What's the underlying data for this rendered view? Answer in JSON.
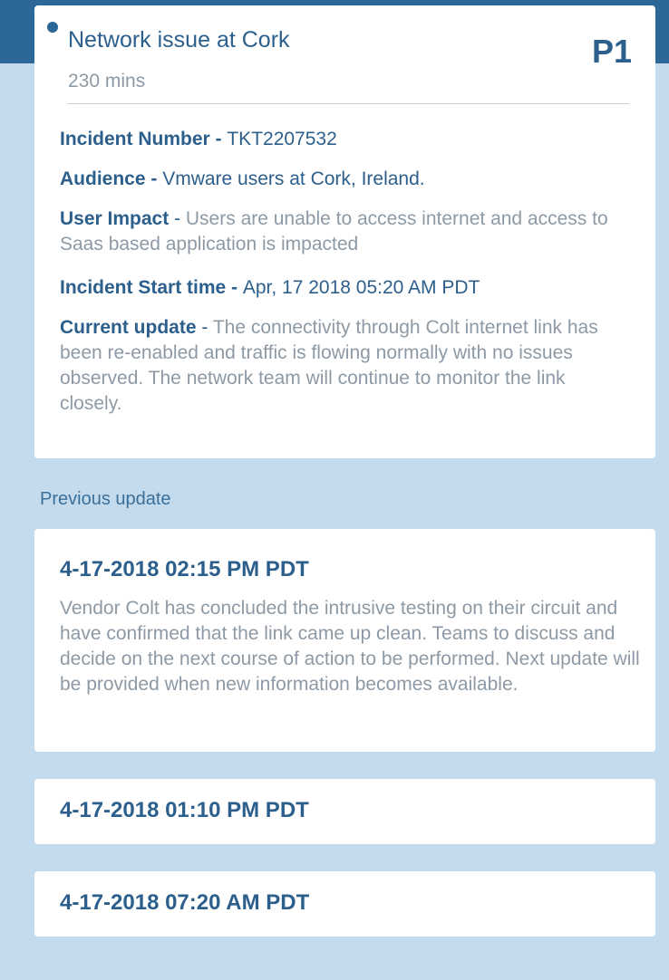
{
  "incident": {
    "title": "Network issue at Cork",
    "duration": "230 mins",
    "priority": "P1",
    "fields": {
      "incident_number": {
        "label": "Incident Number - ",
        "value": "TKT2207532"
      },
      "audience": {
        "label": "Audience - ",
        "value": "Vmware users at Cork, Ireland."
      },
      "user_impact": {
        "label": "User Impact",
        "separator": " - ",
        "value": "Users are unable to access internet and access to Saas based application is impacted"
      },
      "start_time": {
        "label": "Incident Start time - ",
        "value": "Apr, 17 2018 05:20 AM PDT"
      },
      "current_update": {
        "label": "Current update",
        "separator": " - ",
        "value": "The connectivity through Colt internet link has been re-enabled and traffic is flowing normally with no issues observed. The network team will continue to monitor the link closely."
      }
    }
  },
  "previous_updates": {
    "heading": "Previous update",
    "items": [
      {
        "time": "4-17-2018 02:15 PM PDT",
        "text": "Vendor Colt has concluded the intrusive testing on their circuit and have confirmed that the link came up clean. Teams to discuss and decide on the next course of action to be performed. Next update will be provided when new information becomes available."
      },
      {
        "time": "4-17-2018 01:10 PM PDT"
      },
      {
        "time": "4-17-2018 07:20 AM PDT"
      }
    ]
  },
  "colors": {
    "header": "#2c6797",
    "background": "#c4dbee",
    "accent_text": "#2c5f8c",
    "muted_text": "#8d9aa6"
  }
}
